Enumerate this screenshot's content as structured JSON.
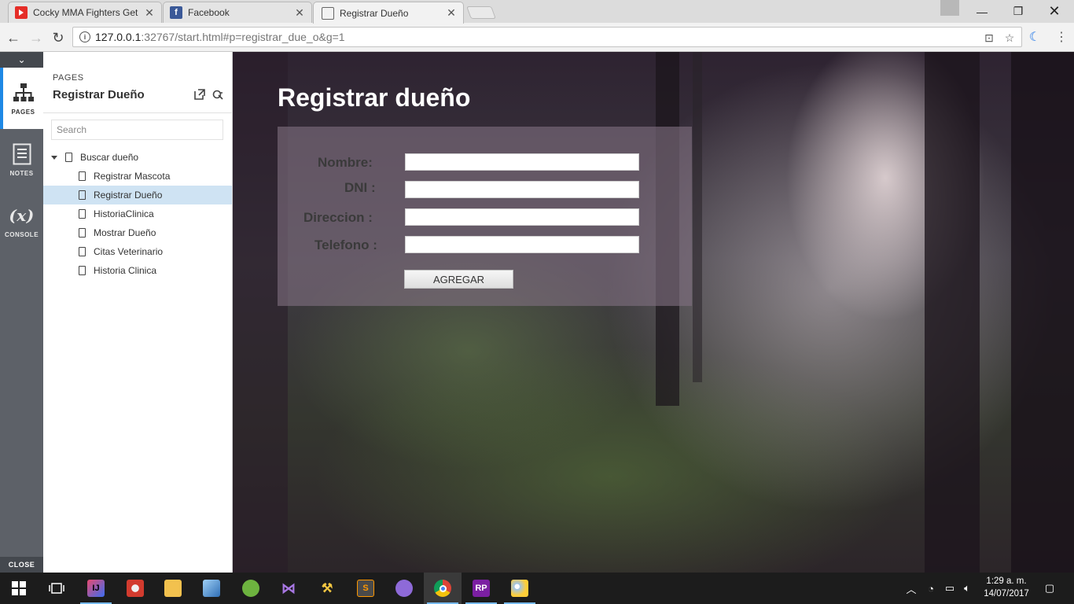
{
  "browser": {
    "tabs": [
      {
        "title": "Cocky MMA Fighters Get",
        "favicon": "youtube-icon"
      },
      {
        "title": "Facebook",
        "favicon": "facebook-icon"
      },
      {
        "title": "Registrar Dueño",
        "favicon": "document-icon"
      }
    ],
    "url_host": "127.0.0.1",
    "url_rest": ":32767/start.html#p=registrar_due_o&g=1"
  },
  "rail": {
    "pages_label": "PAGES",
    "notes_label": "NOTES",
    "console_label": "CONSOLE",
    "close_label": "CLOSE"
  },
  "panel": {
    "label": "PAGES",
    "title": "Registrar Dueño",
    "search_placeholder": "Search",
    "tree": {
      "root": "Buscar dueño",
      "children": [
        "Registrar Mascota",
        "Registrar Dueño",
        "HistoriaClinica",
        "Mostrar Dueño",
        "Citas Veterinario",
        "Historia Clinica"
      ]
    }
  },
  "form": {
    "title": "Registrar dueño",
    "fields": {
      "nombre": "Nombre:",
      "dni": "DNI :",
      "direccion": "Direccion :",
      "telefono": "Telefono :"
    },
    "button": "AGREGAR"
  },
  "taskbar": {
    "time": "1:29 a. m.",
    "date": "14/07/2017"
  },
  "colors": {
    "accent": "#1e88e5",
    "selected_row": "#cfe3f3",
    "form_box": "#807080"
  }
}
